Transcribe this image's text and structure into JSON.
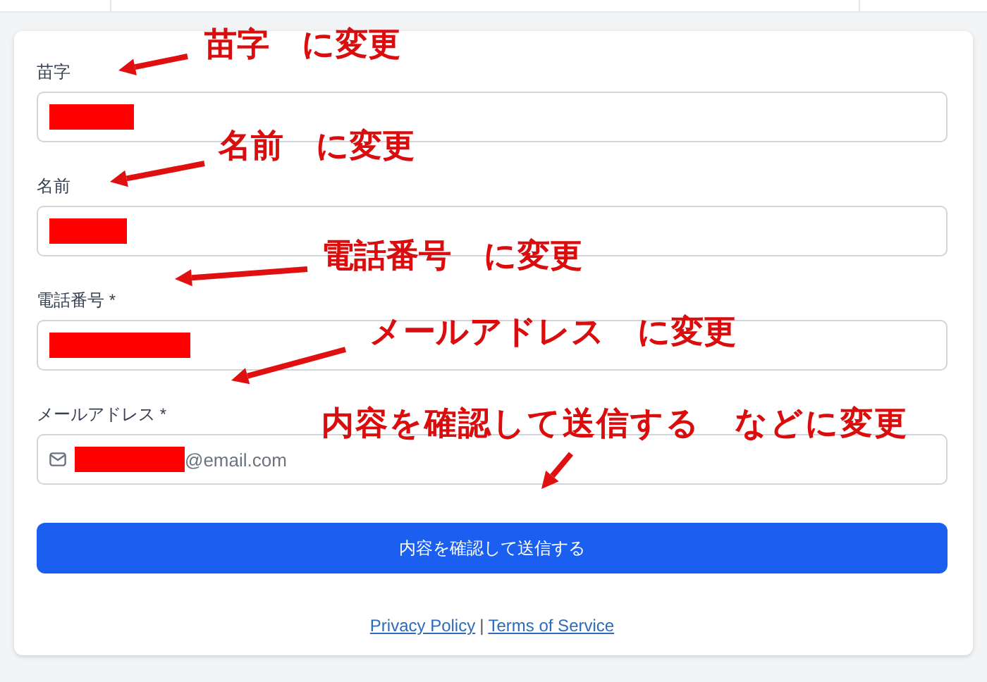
{
  "form": {
    "fields": [
      {
        "label": "苗字",
        "redacted": true
      },
      {
        "label": "名前",
        "redacted": true
      },
      {
        "label": "電話番号 *",
        "redacted": true
      },
      {
        "label": "メールアドレス *",
        "redacted": true,
        "kind": "email",
        "value": "@email.com"
      }
    ],
    "submit_button": "内容を確認して送信する",
    "footer_links": [
      {
        "text": "Privacy Policy"
      },
      {
        "text": "Terms of Service"
      }
    ],
    "footer_separator": "|"
  },
  "annotations": [
    {
      "text": "苗字　に変更"
    },
    {
      "text": "名前　に変更"
    },
    {
      "text": "電話番号　に変更"
    },
    {
      "text": "メールアドレス　に変更"
    },
    {
      "text": "内容を確認して送信する　などに変更"
    }
  ]
}
